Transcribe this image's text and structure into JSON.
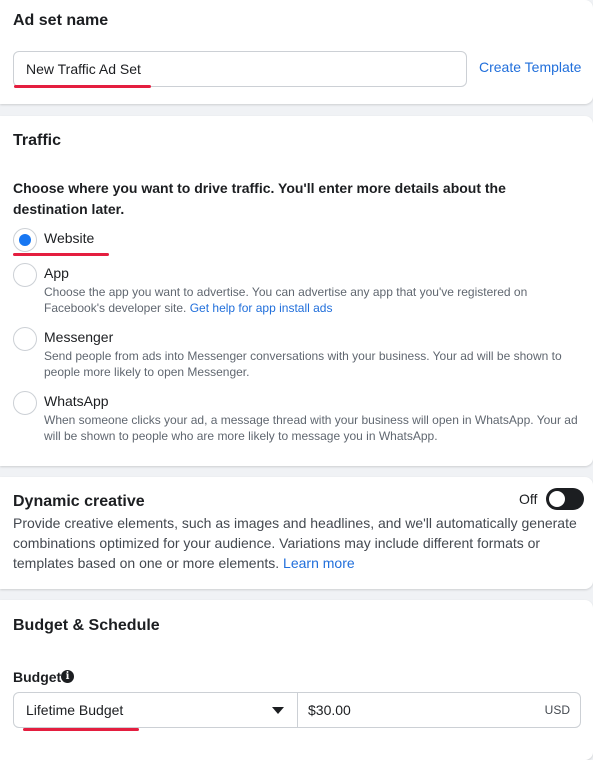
{
  "ad_set_name": {
    "title": "Ad set name",
    "input_value": "New Traffic Ad Set",
    "create_template_link": "Create Template"
  },
  "traffic": {
    "title": "Traffic",
    "description": "Choose where you want to drive traffic. You'll enter more details about the destination later.",
    "selected": "Website",
    "options": [
      {
        "label": "Website",
        "description": "",
        "checked": true
      },
      {
        "label": "App",
        "description": "Choose the app you want to advertise. You can advertise any app that you've registered on Facebook's developer site.",
        "link": "Get help for app install ads",
        "checked": false
      },
      {
        "label": "Messenger",
        "description": "Send people from ads into Messenger conversations with your business. Your ad will be shown to people more likely to open Messenger.",
        "checked": false
      },
      {
        "label": "WhatsApp",
        "description": "When someone clicks your ad, a message thread with your business will open in WhatsApp. Your ad will be shown to people who are more likely to message you in WhatsApp.",
        "checked": false
      }
    ]
  },
  "dynamic_creative": {
    "title": "Dynamic creative",
    "toggle_label": "Off",
    "toggle_on": false,
    "description": "Provide creative elements, such as images and headlines, and we'll automatically generate combinations optimized for your audience. Variations may include different formats or templates based on one or more elements.",
    "learn_more": "Learn more"
  },
  "budget_schedule": {
    "title": "Budget & Schedule",
    "budget_label": "Budget",
    "info_icon": "info-icon",
    "budget_type": "Lifetime Budget",
    "amount": "$30.00",
    "currency": "USD"
  },
  "colors": {
    "accent": "#1877f2",
    "link": "#216fdb",
    "annotation_underline": "#e41e3f",
    "background": "#f0f2f5"
  }
}
